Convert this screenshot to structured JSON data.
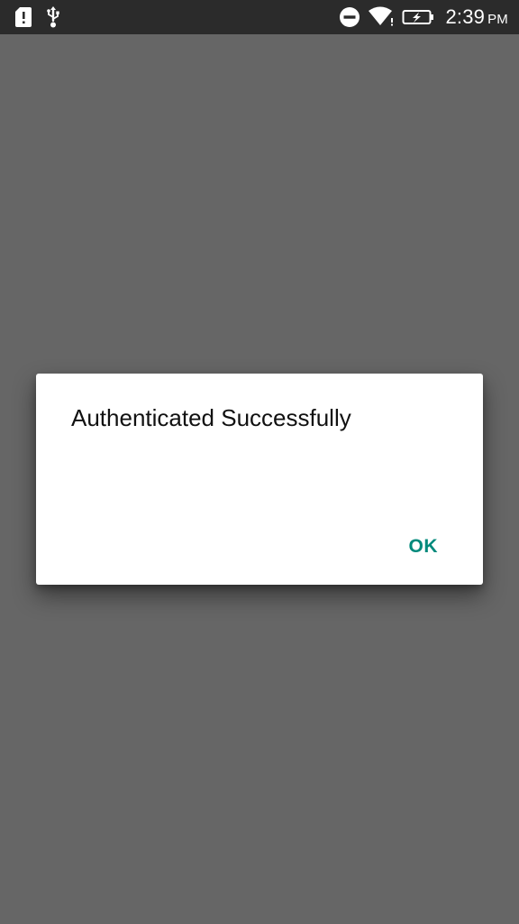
{
  "colors": {
    "status_bar_bg": "#2b2b2b",
    "scrim": "#666666",
    "dialog_bg": "#ffffff",
    "accent": "#00897b"
  },
  "status_bar": {
    "left_icons": [
      "sd-card-alert-icon",
      "usb-icon"
    ],
    "right_icons": [
      "do-not-disturb-icon",
      "wifi-icon",
      "battery-charging-icon"
    ],
    "time": "2:39",
    "ampm": "PM"
  },
  "dialog": {
    "title": "Authenticated Successfully",
    "ok_label": "OK"
  }
}
